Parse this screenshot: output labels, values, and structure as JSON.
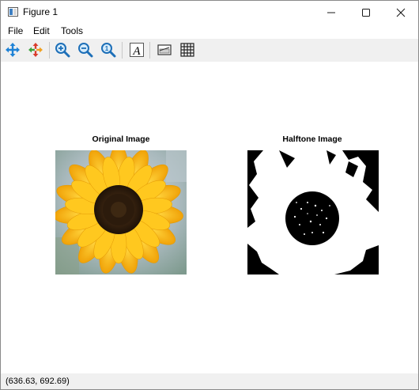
{
  "window": {
    "title": "Figure 1",
    "minimize_icon": "minimize-icon",
    "maximize_icon": "maximize-icon",
    "close_icon": "close-icon"
  },
  "menu": {
    "items": [
      {
        "label": "File"
      },
      {
        "label": "Edit"
      },
      {
        "label": "Tools"
      }
    ]
  },
  "toolbar": {
    "buttons": [
      {
        "icon": "pan-icon",
        "tooltip": "Pan"
      },
      {
        "icon": "move-icon",
        "tooltip": "Move"
      },
      {
        "icon": "zoom-in-icon",
        "tooltip": "Zoom in"
      },
      {
        "icon": "zoom-out-icon",
        "tooltip": "Zoom out"
      },
      {
        "icon": "zoom-reset-icon",
        "tooltip": "Zoom 1:1"
      },
      {
        "icon": "text-icon",
        "tooltip": "Insert text",
        "glyph": "A"
      },
      {
        "icon": "colorbar-icon",
        "tooltip": "Colorbar"
      },
      {
        "icon": "grid-icon",
        "tooltip": "Grid"
      }
    ]
  },
  "figure": {
    "left_title": "Original Image",
    "right_title": "Halftone Image",
    "colors": {
      "petal": "#f6b80e",
      "petal_dark": "#e59a05",
      "center": "#3a2410",
      "background_blur": "#b7c4c8"
    }
  },
  "status": {
    "coordinates": "(636.63, 692.69)"
  }
}
